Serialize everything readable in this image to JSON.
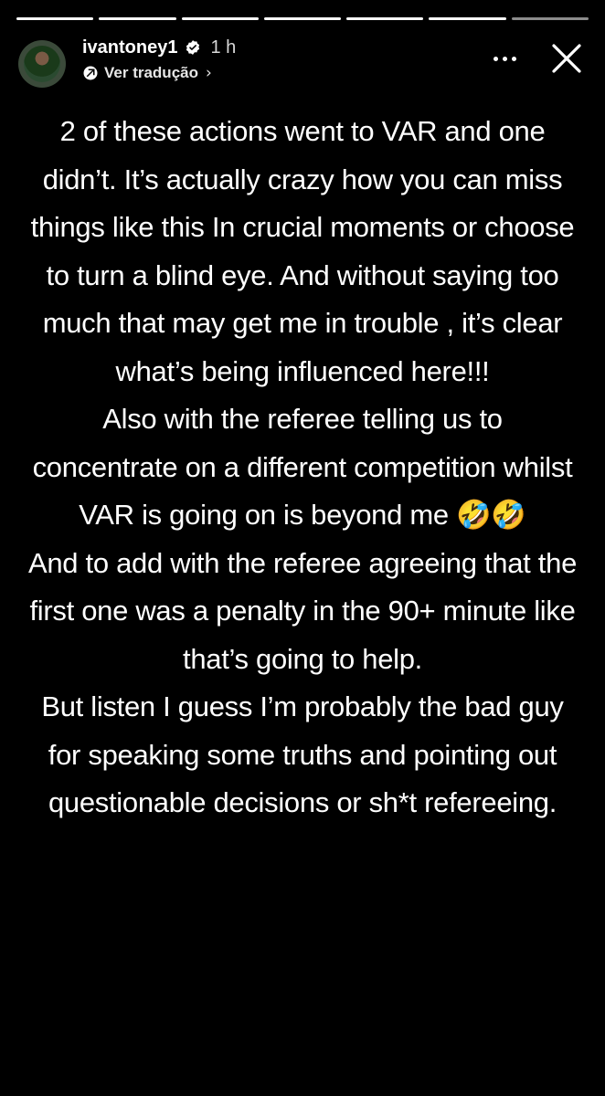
{
  "progress": {
    "segments": 7,
    "active_index": 6
  },
  "header": {
    "username": "ivantoney1",
    "verified": true,
    "time": "1 h",
    "translate_label": "Ver tradução",
    "translate_chevron": "›"
  },
  "story": {
    "paragraphs": [
      "2 of these actions went to VAR and one didn’t. It’s actually crazy how you can miss things like this In crucial moments or choose to turn a blind eye. And without saying too much that may get me in trouble , it’s clear what’s being influenced here!!!",
      "Also with the referee telling us to concentrate on a different competition whilst VAR is going on is beyond me 🤣🤣",
      "And to add with the referee agreeing that the first one was a penalty in the 90+ minute like that’s going to help.",
      "But listen I guess I’m probably the bad guy for speaking some truths and pointing out questionable decisions or sh*t refereeing."
    ]
  },
  "colors": {
    "background": "#000000",
    "text": "#ffffff",
    "verified": "#3797f0"
  },
  "icons": {
    "verified": "verified-badge-icon",
    "translate": "translate-icon",
    "more": "more-options-icon",
    "close": "close-icon"
  }
}
